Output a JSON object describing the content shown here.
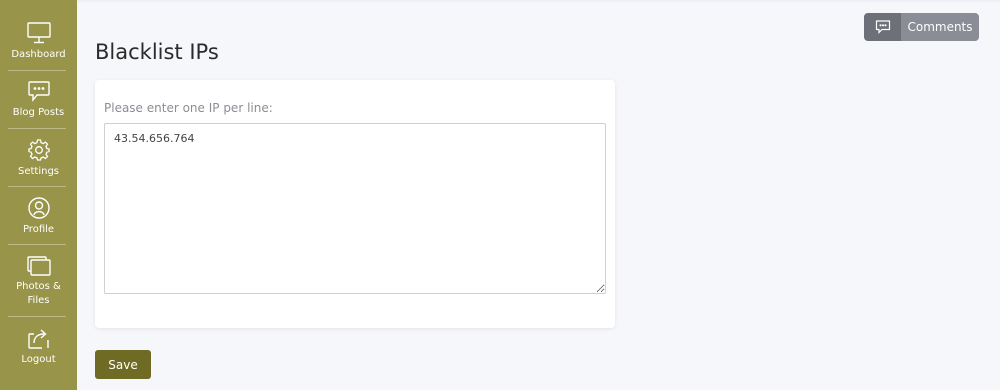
{
  "sidebar": {
    "items": [
      {
        "label": "Dashboard",
        "icon": "monitor-icon"
      },
      {
        "label": "Blog Posts",
        "icon": "comment-icon"
      },
      {
        "label": "Settings",
        "icon": "gear-icon"
      },
      {
        "label": "Profile",
        "icon": "user-icon"
      },
      {
        "label": "Photos &\nFiles",
        "icon": "photos-icon"
      },
      {
        "label": "Logout",
        "icon": "logout-icon"
      }
    ]
  },
  "header": {
    "comments_label": "Comments"
  },
  "main": {
    "title": "Blacklist IPs",
    "field_label": "Please enter one IP per line:",
    "textarea_value": "43.54.656.764",
    "save_label": "Save"
  },
  "colors": {
    "sidebar": "#98944a",
    "save_button": "#6f6b24",
    "comments_button": "#8a8c96",
    "background": "#f6f7fb"
  }
}
